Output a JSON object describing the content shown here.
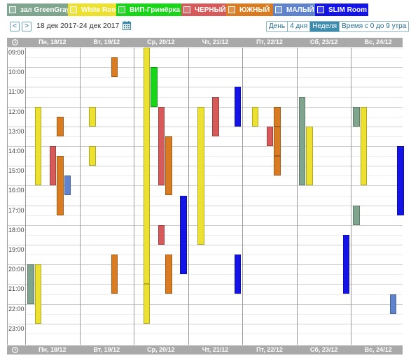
{
  "rooms": [
    {
      "label": "зал GreenGray",
      "color": "#7fa58e"
    },
    {
      "label": "White Room",
      "color": "#ece12f"
    },
    {
      "label": "ВИП-Гримёрка",
      "color": "#17d617"
    },
    {
      "label": "ЧЕРНЫЙ",
      "color": "#d75a5a"
    },
    {
      "label": "ЮЖНЫЙ",
      "color": "#d97b20"
    },
    {
      "label": "МАЛЫЙ",
      "color": "#5f83cc"
    },
    {
      "label": "SLIM Room",
      "color": "#1414e6"
    }
  ],
  "nav": {
    "prev": "<",
    "next": ">",
    "range": "18 дек 2017-24 дек 2017"
  },
  "views": [
    {
      "label": "День",
      "active": false
    },
    {
      "label": "4 дня",
      "active": false
    },
    {
      "label": "Неделя",
      "active": true
    },
    {
      "label": "Время с 0 до 9 утра",
      "active": false
    }
  ],
  "days": [
    "Пн, 18/12",
    "Вт, 19/12",
    "Ср, 20/12",
    "Чт, 21/12",
    "Пт, 22/12",
    "Сб, 23/12",
    "Вс, 24/12"
  ],
  "hours": [
    "09:00",
    "10:00",
    "11:00",
    "12:00",
    "13:00",
    "14:00",
    "15:00",
    "16:00",
    "17:00",
    "18:00",
    "19:00",
    "20:00",
    "21:00",
    "22:00",
    "23:00"
  ],
  "bookings": [
    {
      "day": 0,
      "room": 1,
      "start": 12.0,
      "end": 16.0
    },
    {
      "day": 0,
      "room": 4,
      "start": 12.5,
      "end": 13.5
    },
    {
      "day": 0,
      "room": 3,
      "start": 14.0,
      "end": 16.0
    },
    {
      "day": 0,
      "room": 4,
      "start": 14.5,
      "end": 17.5
    },
    {
      "day": 0,
      "room": 5,
      "start": 15.5,
      "end": 16.5
    },
    {
      "day": 0,
      "room": 0,
      "start": 20.0,
      "end": 22.0
    },
    {
      "day": 0,
      "room": 1,
      "start": 20.0,
      "end": 23.0
    },
    {
      "day": 1,
      "room": 4,
      "start": 9.5,
      "end": 10.5
    },
    {
      "day": 1,
      "room": 1,
      "start": 12.0,
      "end": 13.0
    },
    {
      "day": 1,
      "room": 1,
      "start": 14.0,
      "end": 15.0
    },
    {
      "day": 1,
      "room": 4,
      "start": 19.5,
      "end": 21.5
    },
    {
      "day": 2,
      "room": 1,
      "start": 9.0,
      "end": 21.0
    },
    {
      "day": 2,
      "room": 2,
      "start": 10.0,
      "end": 12.0
    },
    {
      "day": 2,
      "room": 3,
      "start": 12.0,
      "end": 16.0
    },
    {
      "day": 2,
      "room": 4,
      "start": 13.5,
      "end": 16.5
    },
    {
      "day": 2,
      "room": 6,
      "start": 16.5,
      "end": 20.5
    },
    {
      "day": 2,
      "room": 3,
      "start": 18.0,
      "end": 19.0
    },
    {
      "day": 2,
      "room": 4,
      "start": 19.5,
      "end": 21.5
    },
    {
      "day": 2,
      "room": 1,
      "start": 21.0,
      "end": 23.0
    },
    {
      "day": 3,
      "room": 3,
      "start": 11.5,
      "end": 13.5
    },
    {
      "day": 3,
      "room": 6,
      "start": 11.0,
      "end": 13.0
    },
    {
      "day": 3,
      "room": 1,
      "start": 12.0,
      "end": 19.0
    },
    {
      "day": 3,
      "room": 6,
      "start": 19.5,
      "end": 21.5
    },
    {
      "day": 4,
      "room": 1,
      "start": 12.0,
      "end": 13.0
    },
    {
      "day": 4,
      "room": 4,
      "start": 12.0,
      "end": 13.0
    },
    {
      "day": 4,
      "room": 3,
      "start": 13.0,
      "end": 14.0
    },
    {
      "day": 4,
      "room": 4,
      "start": 13.0,
      "end": 14.5
    },
    {
      "day": 4,
      "room": 4,
      "start": 14.5,
      "end": 15.5
    },
    {
      "day": 5,
      "room": 0,
      "start": 11.5,
      "end": 16.0
    },
    {
      "day": 5,
      "room": 1,
      "start": 13.0,
      "end": 16.0
    },
    {
      "day": 5,
      "room": 6,
      "start": 18.5,
      "end": 21.5
    },
    {
      "day": 6,
      "room": 0,
      "start": 12.0,
      "end": 13.0
    },
    {
      "day": 6,
      "room": 1,
      "start": 12.0,
      "end": 16.0
    },
    {
      "day": 6,
      "room": 0,
      "start": 17.0,
      "end": 18.0
    },
    {
      "day": 6,
      "room": 6,
      "start": 14.0,
      "end": 17.5
    },
    {
      "day": 6,
      "room": 5,
      "start": 21.5,
      "end": 22.5
    }
  ]
}
